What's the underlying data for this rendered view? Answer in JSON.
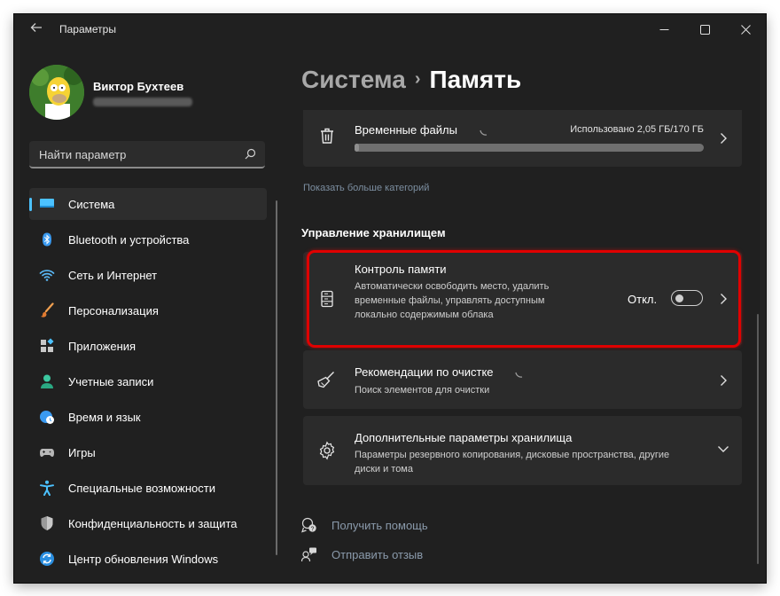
{
  "window": {
    "title": "Параметры"
  },
  "user": {
    "name": "Виктор Бухтеев"
  },
  "search": {
    "placeholder": "Найти параметр"
  },
  "sidebar": {
    "items": [
      {
        "label": "Система",
        "icon": "system-icon",
        "active": true
      },
      {
        "label": "Bluetooth и устройства",
        "icon": "bluetooth-icon"
      },
      {
        "label": "Сеть и Интернет",
        "icon": "wifi-icon"
      },
      {
        "label": "Персонализация",
        "icon": "brush-icon"
      },
      {
        "label": "Приложения",
        "icon": "apps-icon"
      },
      {
        "label": "Учетные записи",
        "icon": "account-icon"
      },
      {
        "label": "Время и язык",
        "icon": "globe-clock-icon"
      },
      {
        "label": "Игры",
        "icon": "gamepad-icon"
      },
      {
        "label": "Специальные возможности",
        "icon": "accessibility-icon"
      },
      {
        "label": "Конфиденциальность и защита",
        "icon": "shield-icon"
      },
      {
        "label": "Центр обновления Windows",
        "icon": "update-icon"
      }
    ]
  },
  "breadcrumb": {
    "parent": "Система",
    "separator": "›",
    "current": "Память"
  },
  "temp_files": {
    "title": "Временные файлы",
    "usage": "Использовано 2,05 ГБ/170 ГБ",
    "progress": 0.012
  },
  "show_more": "Показать больше категорий",
  "section": {
    "title": "Управление хранилищем"
  },
  "storage_sense": {
    "title": "Контроль памяти",
    "description": "Автоматически освободить место, удалить временные файлы, управлять доступным локально содержимым облака",
    "toggle_label": "Откл.",
    "enabled": false
  },
  "cleanup": {
    "title": "Рекомендации по очистке",
    "subtitle": "Поиск элементов для очистки"
  },
  "advanced": {
    "title": "Дополнительные параметры хранилища",
    "subtitle": "Параметры резервного копирования, дисковые пространства, другие диски и тома"
  },
  "footer": {
    "help": "Получить помощь",
    "feedback": "Отправить отзыв"
  },
  "colors": {
    "accent": "#4cc2ff",
    "highlight": "#e00000",
    "background": "#202020",
    "card": "#2b2b2b"
  }
}
